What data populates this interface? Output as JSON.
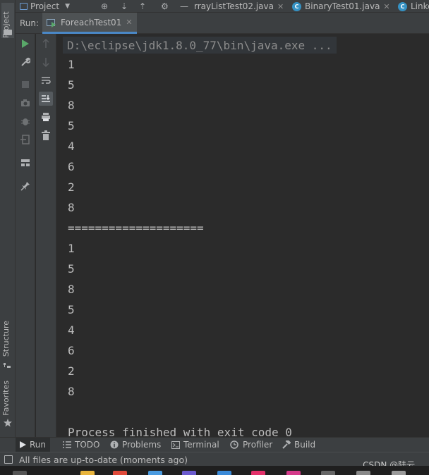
{
  "left_strip": {
    "project_label": "Project",
    "structure_label": "Structure",
    "favorites_label": "Favorites"
  },
  "top_bar": {
    "project_dropdown": "Project",
    "tabs": [
      {
        "label": "rrayListTest02.java"
      },
      {
        "label": "BinaryTest01.java"
      },
      {
        "label": "Linke"
      }
    ]
  },
  "run_panel": {
    "run_label": "Run:",
    "tab_label": "ForeachTest01"
  },
  "console": {
    "command": "D:\\eclipse\\jdk1.8.0_77\\bin\\java.exe ...",
    "lines": [
      "1",
      "5",
      "8",
      "5",
      "4",
      "6",
      "2",
      "8",
      "====================",
      "1",
      "5",
      "8",
      "5",
      "4",
      "6",
      "2",
      "8",
      "",
      "Process finished with exit code 0"
    ]
  },
  "bottom_bar": {
    "items": [
      {
        "label": "Run",
        "icon": "play-icon"
      },
      {
        "label": "TODO",
        "icon": "list-icon"
      },
      {
        "label": "Problems",
        "icon": "info-icon"
      },
      {
        "label": "Terminal",
        "icon": "terminal-icon"
      },
      {
        "label": "Profiler",
        "icon": "profiler-icon"
      },
      {
        "label": "Build",
        "icon": "hammer-icon"
      }
    ]
  },
  "status_bar": {
    "text": "All files are up-to-date (moments ago)"
  },
  "watermark": "CSDN @陆云.",
  "colors": {
    "accent": "#4a88c7",
    "run_green": "#59a869",
    "class_badge": "#3592c4",
    "console_bg": "#2b2b2b",
    "panel_bg": "#3c3f41"
  }
}
